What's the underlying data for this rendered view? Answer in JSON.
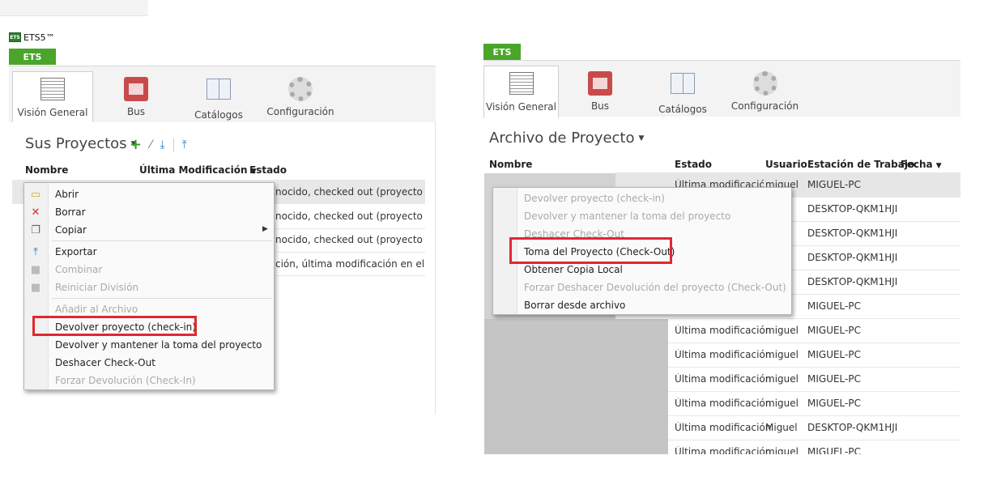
{
  "app": {
    "window_title": "ETS5™",
    "logo_text": "ETS",
    "tab_label": "ETS"
  },
  "ribbon": {
    "tabs": [
      {
        "label": "Visión General",
        "icon": "overview-icon",
        "active": true
      },
      {
        "label": "Bus",
        "icon": "bus-icon"
      },
      {
        "label": "Catálogos",
        "icon": "catalog-book-icon"
      },
      {
        "label": "Configuración",
        "icon": "settings-gear-icon"
      }
    ]
  },
  "left": {
    "section_title": "Sus Proyectos",
    "columns": {
      "name": "Nombre",
      "modified": "Última Modificación",
      "state": "Estado"
    },
    "rows": [
      {
        "state": "nocido, checked out (proyecto tom"
      },
      {
        "state": "nocido, checked out (proyecto toma"
      },
      {
        "state": "nocido, checked out (proyecto toma"
      },
      {
        "state": "ción, última modificación en el archi"
      }
    ],
    "menu": {
      "items": [
        {
          "label": "Abrir",
          "icon": "folder-open-icon",
          "disabled": false
        },
        {
          "label": "Borrar",
          "icon": "delete-x-icon",
          "disabled": false
        },
        {
          "label": "Copiar",
          "icon": "copy-icon",
          "disabled": false,
          "submenu": true
        },
        {
          "label": "Exportar",
          "icon": "export-icon",
          "disabled": false
        },
        {
          "label": "Combinar",
          "icon": "lock-icon",
          "disabled": true
        },
        {
          "label": "Reiniciar División",
          "icon": "lock-icon",
          "disabled": true
        },
        {
          "label": "Añadir al Archivo",
          "disabled": true
        },
        {
          "label": "Devolver proyecto (check-in)",
          "disabled": false,
          "highlighted": true
        },
        {
          "label": "Devolver y mantener la toma del proyecto",
          "disabled": false
        },
        {
          "label": "Deshacer Check-Out",
          "disabled": false
        },
        {
          "label": "Forzar Devolución (Check-In)",
          "disabled": true
        }
      ]
    }
  },
  "right": {
    "section_title": "Archivo de Proyecto",
    "columns": {
      "name": "Nombre",
      "state": "Estado",
      "user": "Usuario",
      "workstation": "Estación de Trabajo",
      "date": "Fecha"
    },
    "rows": [
      {
        "state": "Última modificación",
        "user": "miguel",
        "ws": "MIGUEL-PC"
      },
      {
        "state": "",
        "user": "",
        "ws": "DESKTOP-QKM1HJI"
      },
      {
        "state": "",
        "user": "",
        "ws": "DESKTOP-QKM1HJI"
      },
      {
        "state": "",
        "user": "",
        "ws": "DESKTOP-QKM1HJI"
      },
      {
        "state": "",
        "user": "",
        "ws": "DESKTOP-QKM1HJI"
      },
      {
        "state": "",
        "user": "",
        "ws": "MIGUEL-PC"
      },
      {
        "state": "Última modificación",
        "user": "miguel",
        "ws": "MIGUEL-PC"
      },
      {
        "state": "Última modificación",
        "user": "miguel",
        "ws": "MIGUEL-PC"
      },
      {
        "state": "Última modificación",
        "user": "miguel",
        "ws": "MIGUEL-PC"
      },
      {
        "state": "Última modificación",
        "user": "miguel",
        "ws": "MIGUEL-PC"
      },
      {
        "state": "Última modificación",
        "user": "Miguel",
        "ws": "DESKTOP-QKM1HJI"
      },
      {
        "state": "Última modificación",
        "user": "miguel",
        "ws": "MIGUEL-PC"
      }
    ],
    "menu": {
      "items": [
        {
          "label": "Devolver proyecto (check-in)",
          "disabled": true
        },
        {
          "label": "Devolver y mantener la toma del proyecto",
          "disabled": true
        },
        {
          "label": "Deshacer Check-Out",
          "disabled": true
        },
        {
          "label": "Toma del Proyecto (Check-Out)",
          "disabled": false,
          "highlighted": true
        },
        {
          "label": "Obtener Copia Local",
          "disabled": false
        },
        {
          "label": "Forzar Deshacer Devolución del proyecto (Check-Out)",
          "disabled": true
        },
        {
          "label": "Borrar desde archivo",
          "disabled": false
        }
      ]
    }
  },
  "colors": {
    "ets_green": "#4aa52a",
    "highlight_red": "#e0282e"
  }
}
